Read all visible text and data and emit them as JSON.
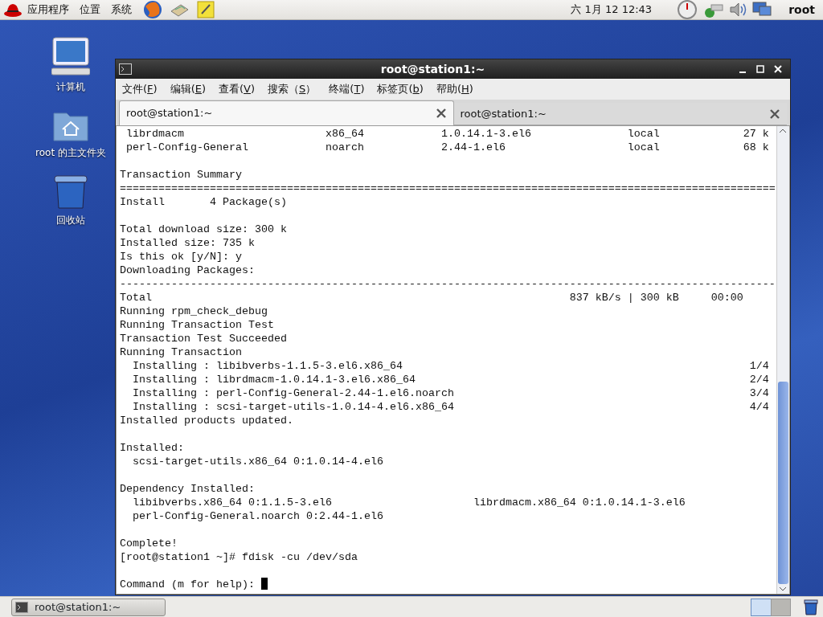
{
  "top_panel": {
    "menus": [
      {
        "label": "应用程序"
      },
      {
        "label": "位置"
      },
      {
        "label": "系统"
      }
    ],
    "clock": "六 1月 12 12:43",
    "user": "root"
  },
  "desktop_icons": [
    {
      "kind": "computer",
      "label": "计算机"
    },
    {
      "kind": "home",
      "label": "root 的主文件夹"
    },
    {
      "kind": "trash",
      "label": "回收站"
    }
  ],
  "window": {
    "title": "root@station1:~",
    "menu": [
      {
        "label": "文件(",
        "accel": "F",
        "tail": ")"
      },
      {
        "label": "编辑(",
        "accel": "E",
        "tail": ")"
      },
      {
        "label": "查看(",
        "accel": "V",
        "tail": ")"
      },
      {
        "label": "搜索（",
        "accel": "S",
        "tail": "）"
      },
      {
        "label": "终端(",
        "accel": "T",
        "tail": ")"
      },
      {
        "label": "标签页(",
        "accel": "b",
        "tail": ")"
      },
      {
        "label": "帮助(",
        "accel": "H",
        "tail": ")"
      }
    ],
    "tabs": [
      {
        "label": "root@station1:~",
        "selected": true
      },
      {
        "label": "root@station1:~",
        "selected": false
      }
    ],
    "terminal_lines": [
      {
        "kind": "text",
        "text": " librdmacm                      x86_64            1.0.14.1-3.el6               local             27 k"
      },
      {
        "kind": "text",
        "text": " perl-Config-General            noarch            2.44-1.el6                   local             68 k"
      },
      {
        "kind": "blank"
      },
      {
        "kind": "text",
        "text": "Transaction Summary"
      },
      {
        "kind": "text",
        "text": "======================================================================================================"
      },
      {
        "kind": "text",
        "text": "Install       4 Package(s)"
      },
      {
        "kind": "blank"
      },
      {
        "kind": "text",
        "text": "Total download size: 300 k"
      },
      {
        "kind": "text",
        "text": "Installed size: 735 k"
      },
      {
        "kind": "text",
        "text": "Is this ok [y/N]: y"
      },
      {
        "kind": "text",
        "text": "Downloading Packages:"
      },
      {
        "kind": "text",
        "text": "------------------------------------------------------------------------------------------------------"
      },
      {
        "kind": "text",
        "text": "Total                                                                 837 kB/s | 300 kB     00:00"
      },
      {
        "kind": "text",
        "text": "Running rpm_check_debug"
      },
      {
        "kind": "text",
        "text": "Running Transaction Test"
      },
      {
        "kind": "text",
        "text": "Transaction Test Succeeded"
      },
      {
        "kind": "text",
        "text": "Running Transaction"
      },
      {
        "kind": "text",
        "text": "  Installing : libibverbs-1.1.5-3.el6.x86_64                                                      1/4"
      },
      {
        "kind": "text",
        "text": "  Installing : librdmacm-1.0.14.1-3.el6.x86_64                                                    2/4"
      },
      {
        "kind": "text",
        "text": "  Installing : perl-Config-General-2.44-1.el6.noarch                                              3/4"
      },
      {
        "kind": "text",
        "text": "  Installing : scsi-target-utils-1.0.14-4.el6.x86_64                                              4/4"
      },
      {
        "kind": "text",
        "text": "Installed products updated."
      },
      {
        "kind": "blank"
      },
      {
        "kind": "text",
        "text": "Installed:"
      },
      {
        "kind": "text",
        "text": "  scsi-target-utils.x86_64 0:1.0.14-4.el6"
      },
      {
        "kind": "blank"
      },
      {
        "kind": "text",
        "text": "Dependency Installed:"
      },
      {
        "kind": "text",
        "text": "  libibverbs.x86_64 0:1.1.5-3.el6                      librdmacm.x86_64 0:1.0.14.1-3.el6"
      },
      {
        "kind": "text",
        "text": "  perl-Config-General.noarch 0:2.44-1.el6"
      },
      {
        "kind": "blank"
      },
      {
        "kind": "text",
        "text": "Complete!"
      },
      {
        "kind": "text",
        "text": "[root@station1 ~]# fdisk -cu /dev/sda"
      },
      {
        "kind": "blank"
      },
      {
        "kind": "prompt",
        "text": "Command (m for help): ",
        "cursor": true
      }
    ]
  },
  "taskbar": {
    "tasks": [
      {
        "label": "root@station1:~"
      }
    ]
  }
}
